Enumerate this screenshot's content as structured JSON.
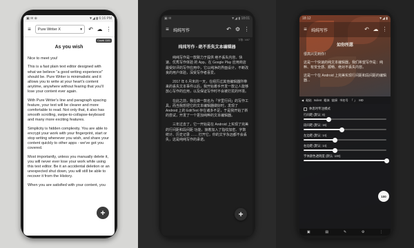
{
  "panel1": {
    "status": {
      "left": "▣ ✉ ⊕",
      "right": "▼◢ ▮ 6:16 PM"
    },
    "title_field": "Pure Writer X",
    "count_badge": "Count: 1101",
    "doc_title": "As you wish",
    "paragraphs": [
      "Nice to meet you!",
      "This is a fast plain text editor designed with what we believe \"a good writing experience\" should be. Pure Writer is minimalistic and it allows you to write at your heart's content anytime, anywhere without fearing that you'll lose your content ever again.",
      "With Pure Writer's line and paragraph spacing feature, your text will be clearer and more comfortable to read. Not only that, it also has smooth scrolling, swipe-to-collapse-keyboard and many more exciting features.",
      "Simplicity is hidden complexity. You are able to encrypt your work with your fingerprint, start or stop writing whenever you wish, and share your content quickly to other apps - we've got you covered.",
      "Most importantly, unless you manually delete it, you will never ever lose your work while using this text editor. Be it an accidental deletion or an unexpected shut down, you will still be able to recover it from the History.",
      "When you are satisfied with your content, you"
    ],
    "colors": {
      "accent": "#3c3c3c",
      "background": "#ffffff"
    }
  },
  "panel2": {
    "status": {
      "left": "▣ ✉",
      "right": "▼◢ ▮ 18:01"
    },
    "app_title": "纯纯写作",
    "small_count": "字数: 1467",
    "doc_title": "纯纯写作 - 绝不丢失文本编辑器",
    "paragraphs": [
      "纯纯写作是一款致力于提供 绝不丢失内容、快速、优秀写作体验 的 App。在 Google Play 应用商店最受好评的写作应用中，它以纯净的界面设计，不断改良的用户体验，深受写作者喜爱。",
      "2017 年 6 月末的一天，在经历过其他编辑器所带来的丢失文本事件以后，我开始着手开发一款让人能够放心写作的应用，以及保证写作时不会被打扰的环境。",
      "在此之前，我在做一款名为「字里行间」的写作工具，而当我想把它的文本编辑器做好时，发现了 Android 上的 EditText 存在诸多不足，于是我开始了新的尝试，开发了一个更加纯粹的文本编辑器。",
      "三年过去了，它一开始是在 Android 上实现了完美的行间距和段间距 功能，接着加入了指纹加密、字数统计、历史记录 …… 打开它，你的文字永远都不会丢失，这是纯纯写作的承诺。"
    ],
    "colors": {
      "background": "#1e1e1e",
      "text": "#cfcfcf"
    }
  },
  "panel3": {
    "status": {
      "left": "18:12",
      "right": "▼◢ ▮"
    },
    "app_title": "纯纯写作",
    "doc_title": "如你所愿",
    "paragraphs": [
      "很高兴见到你！",
      "这是一个快速的纯文本编辑器，我们希望写作是：纯粹、有安全感、顺畅、绝对不丢失内容。",
      "这是一个在 Android 上完美实现行间距和段间距的编辑器..."
    ],
    "format_bar": [
      "◀",
      "粘贴",
      "Indent",
      "粗体",
      "链接",
      "书名号",
      "「 」",
      "MD"
    ],
    "toggles": [
      {
        "label": "休息时专注模式",
        "checked": false
      }
    ],
    "sliders": [
      {
        "label": "行间距 (默认: 8)",
        "value": 0.3
      },
      {
        "label": "段间距 (默认: 16)",
        "value": 0.46
      },
      {
        "label": "左边距 (默认: 14)",
        "value": 0.38
      },
      {
        "label": "右边距 (默认: 14)",
        "value": 0.38
      },
      {
        "label": "字体颜色透明度 (默认: 100)",
        "value": 1.0
      }
    ],
    "value_bubble": "100",
    "bottom_icons": [
      "▣",
      "▤",
      "✎",
      "⚙",
      "⋮"
    ],
    "colors": {
      "background_top": "#7a3a26",
      "background_bottom": "#2a2d31",
      "sheet": "#18181a"
    }
  }
}
